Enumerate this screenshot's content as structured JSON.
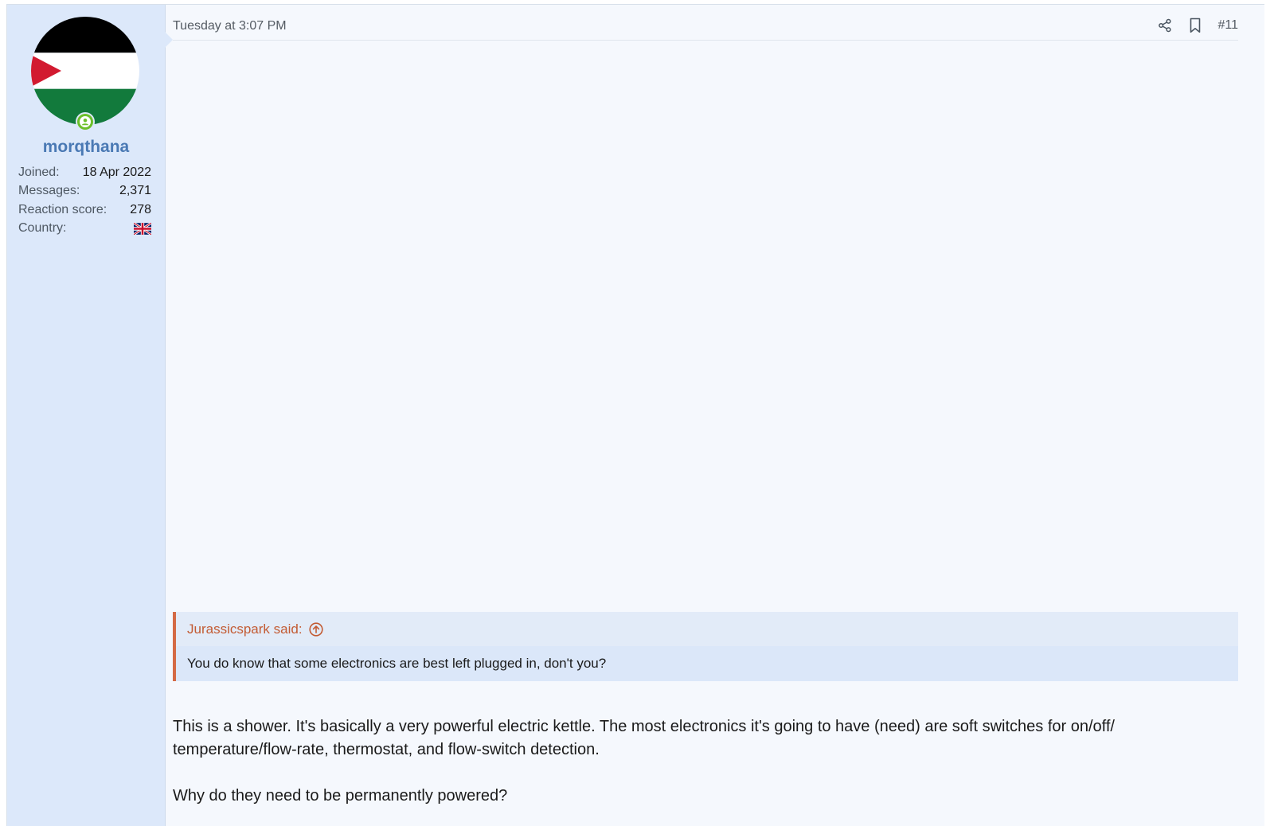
{
  "post": {
    "number": "#11",
    "date": "Tuesday at 3:07 PM",
    "author": {
      "username": "morqthana",
      "avatar": "palestine-flag-avatar",
      "online": true,
      "stats": [
        {
          "label": "Joined:",
          "value": "18 Apr 2022"
        },
        {
          "label": "Messages:",
          "value": "2,371"
        },
        {
          "label": "Reaction score:",
          "value": "278"
        },
        {
          "label": "Country:",
          "value": "uk-flag-icon"
        }
      ]
    },
    "actions": {
      "share_icon": "share-icon",
      "bookmark_icon": "bookmark-icon"
    },
    "quote": {
      "attribution": "Jurassicspark said:",
      "jump_icon": "arrow-up-circle-icon",
      "text": "You do know that some electronics are best left plugged in, don't you?"
    },
    "body": [
      "This is a shower. It's basically a very powerful electric kettle. The most electronics it's going to have (need) are soft switches for on/off/ temperature/flow-rate, thermostat, and flow-switch detection.",
      "Why do they need to be permanently powered?"
    ]
  },
  "colors": {
    "username": "#4a79b4",
    "quote_accent": "#d46a45",
    "user_cell_bg": "#dce8fa",
    "post_bg": "#f5f8fd",
    "online": "#6cbf2a"
  }
}
